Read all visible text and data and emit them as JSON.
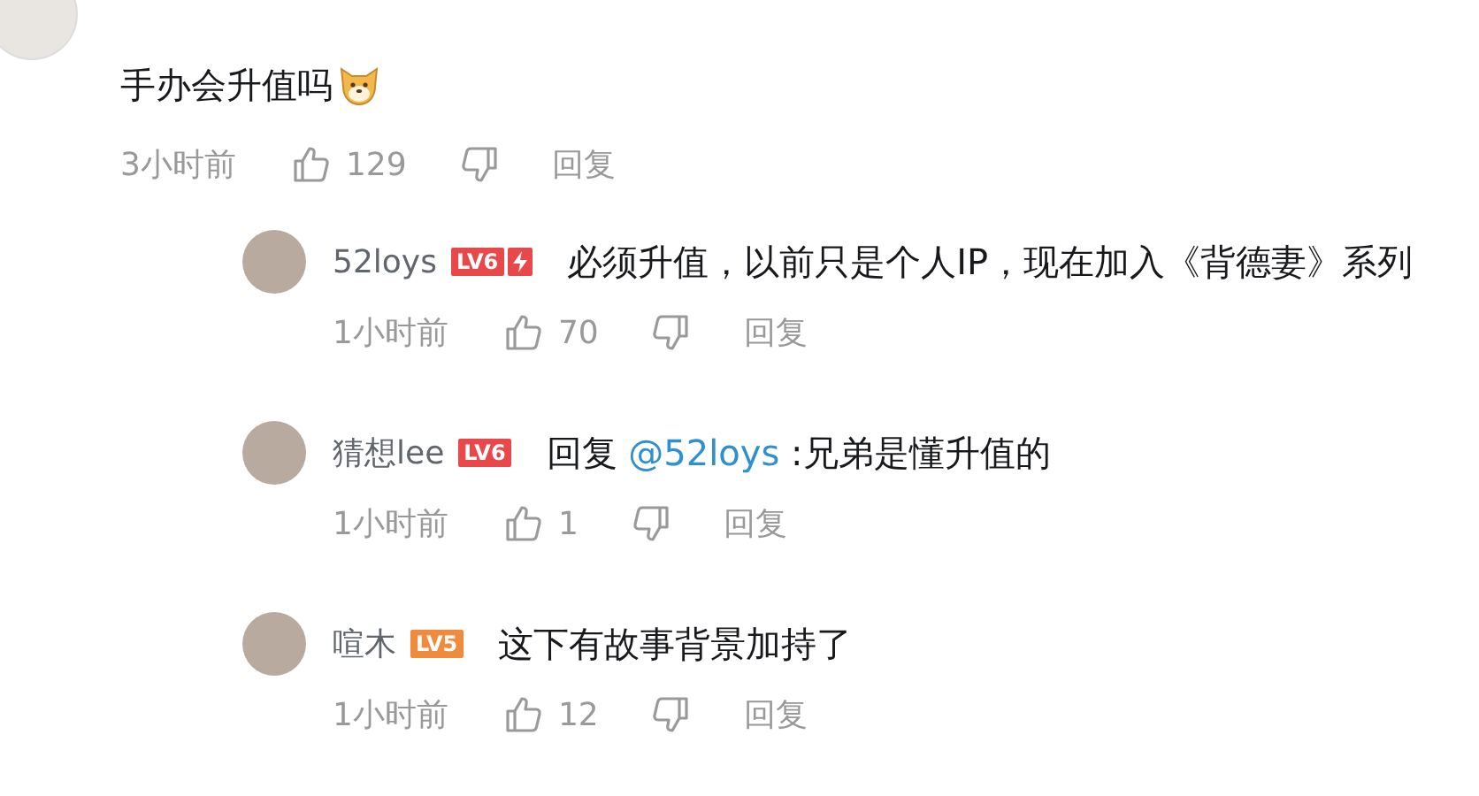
{
  "comment": {
    "text": "手办会升值吗",
    "emoji": true,
    "time": "3小时前",
    "likes": "129",
    "reply_label": "回复",
    "replies": [
      {
        "name": "52loys",
        "level": {
          "text": "LV6",
          "color": "#e8484a",
          "bolt": true
        },
        "content": "必须升值，以前只是个人IP，现在加入《背德妻》系列",
        "time": "1小时前",
        "likes": "70",
        "reply_label": "回复"
      },
      {
        "name": "猜想lee",
        "level": {
          "text": "LV6",
          "color": "#e8484a",
          "bolt": false
        },
        "reply_prefix": "回复",
        "mention": "@52loys",
        "content": " :兄弟是懂升值的",
        "time": "1小时前",
        "likes": "1",
        "reply_label": "回复"
      },
      {
        "name": "喧木",
        "level": {
          "text": "LV5",
          "color": "#f08a3c",
          "bolt": false
        },
        "content": "这下有故事背景加持了",
        "time": "1小时前",
        "likes": "12",
        "reply_label": "回复"
      }
    ]
  }
}
